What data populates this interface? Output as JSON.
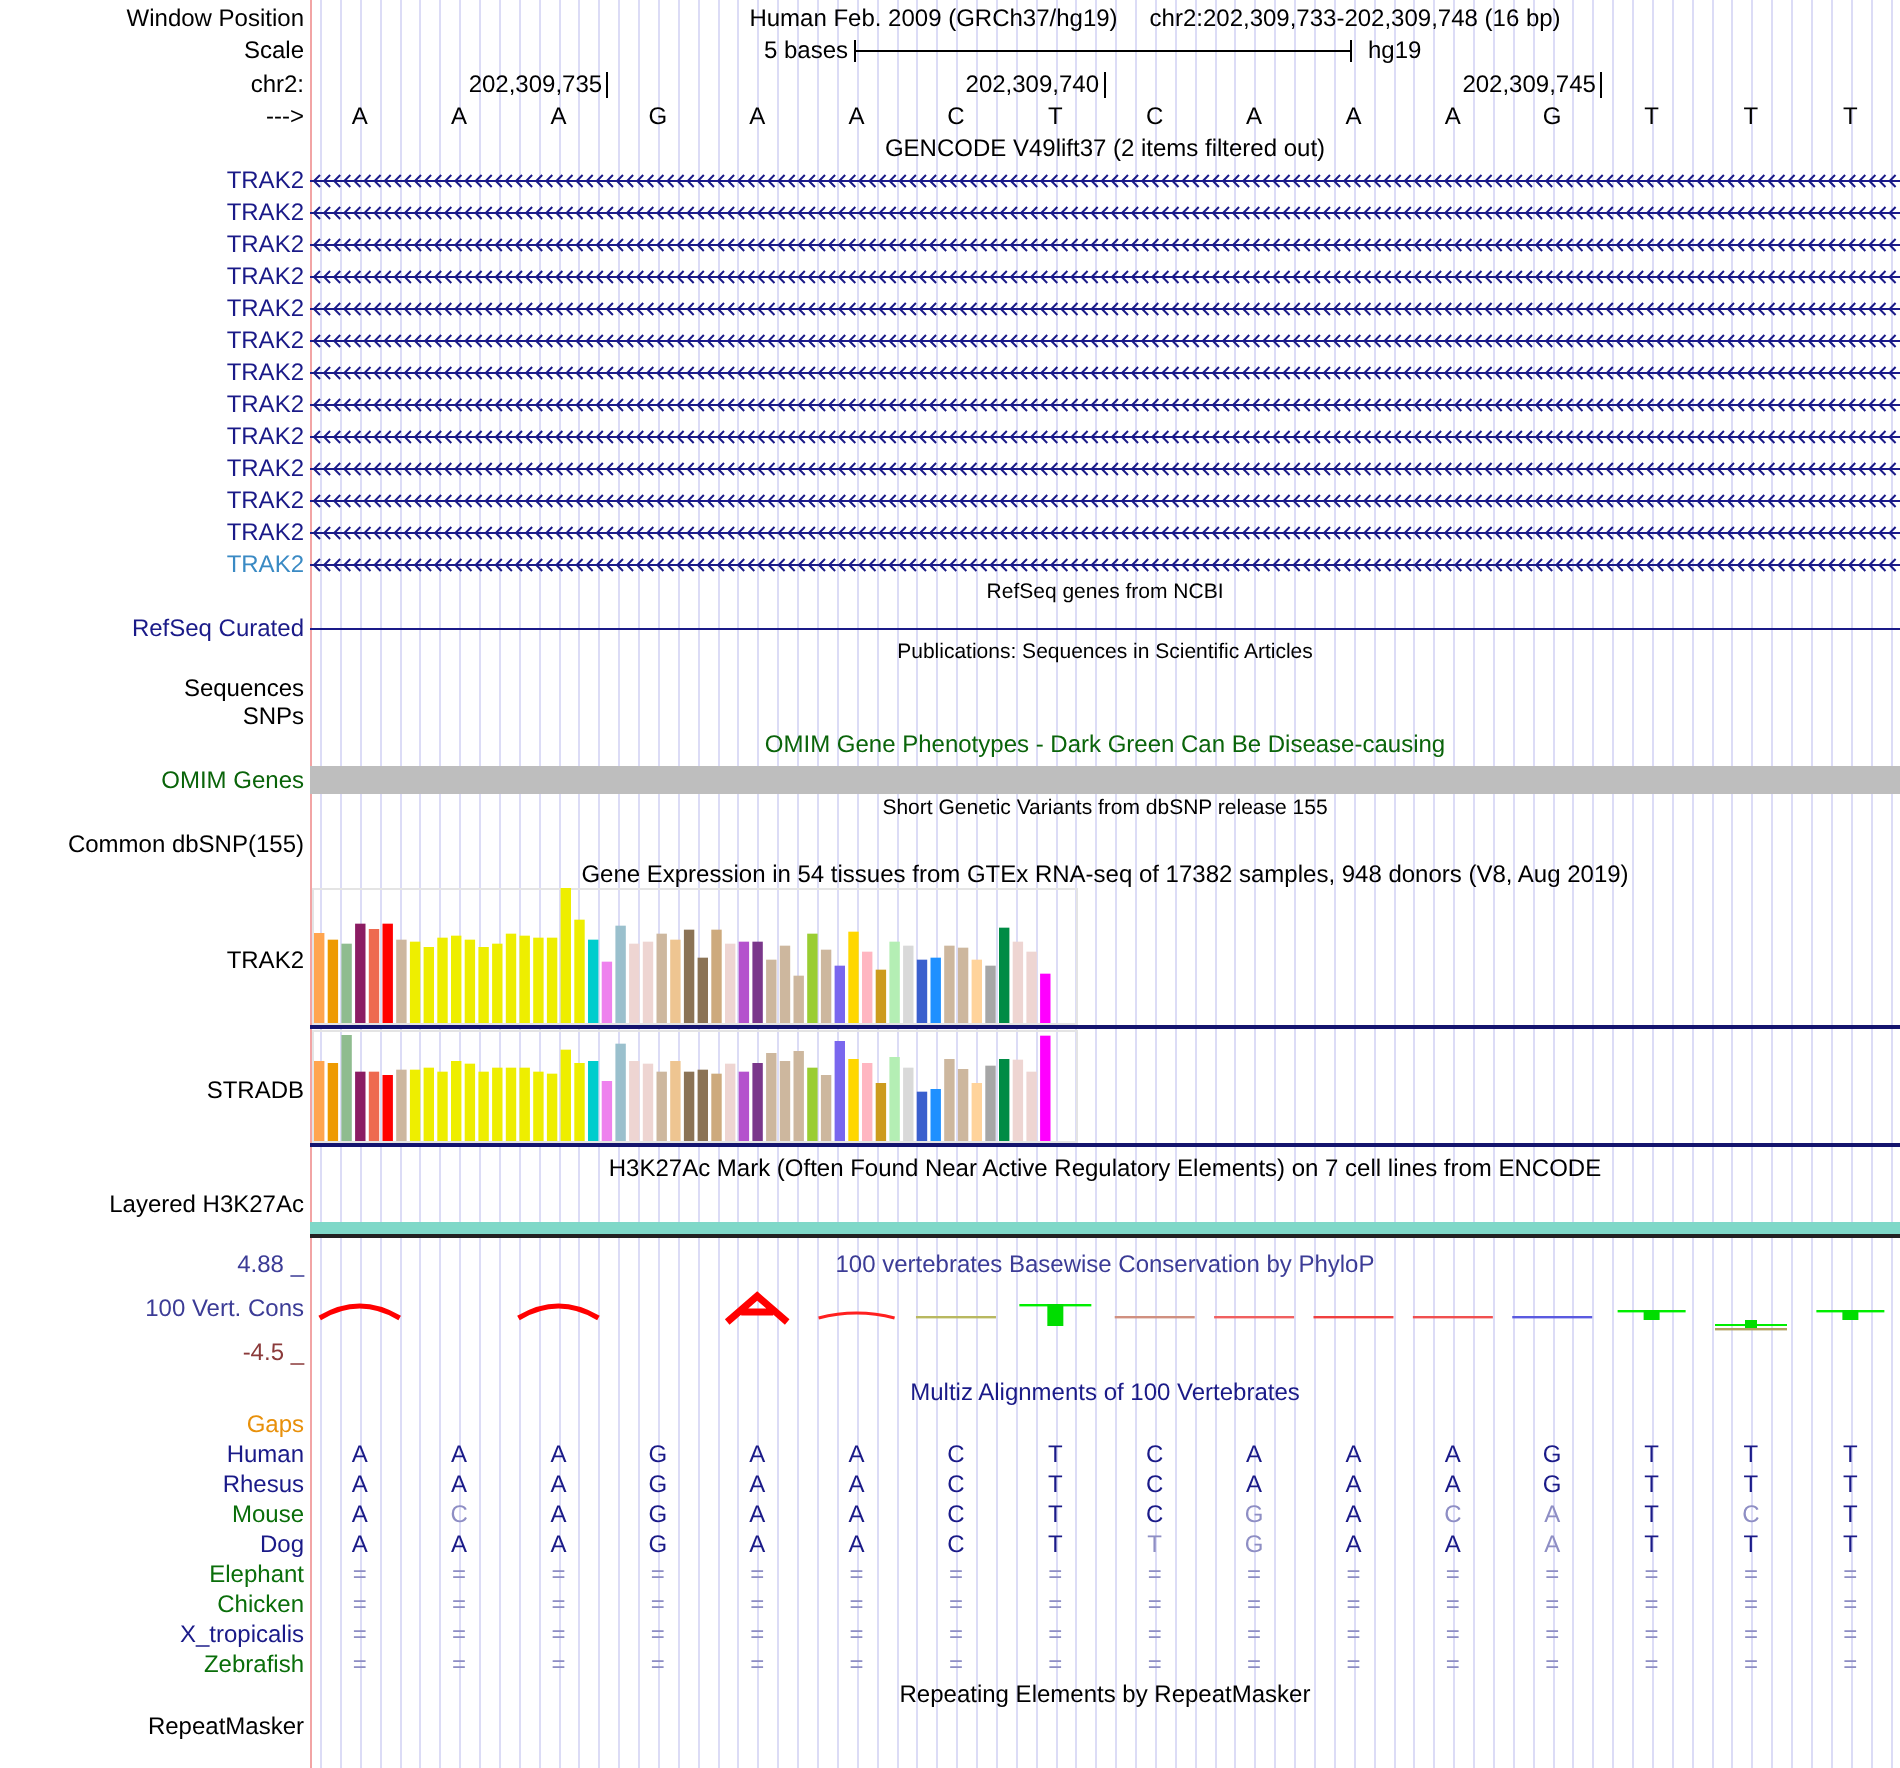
{
  "header": {
    "window_position_label": "Window Position",
    "assembly": "Human Feb. 2009 (GRCh37/hg19)",
    "position": "chr2:202,309,733-202,309,748 (16 bp)",
    "scale_label": "Scale",
    "scale_text": "5 bases",
    "scale_db": "hg19",
    "chrom_label": "chr2:",
    "ruler": [
      "202,309,735",
      "202,309,740",
      "202,309,745"
    ],
    "strand_label": "--->",
    "bases": [
      "A",
      "A",
      "A",
      "G",
      "A",
      "A",
      "C",
      "T",
      "C",
      "A",
      "A",
      "A",
      "G",
      "T",
      "T",
      "T"
    ]
  },
  "tracks": [
    {
      "kind": "genes",
      "heading": {
        "text": "GENCODE V49lift37 (2 items filtered out)",
        "small": false,
        "color": "#000000"
      },
      "items": [
        {
          "label": "TRAK2",
          "color": "#1a1a88"
        },
        {
          "label": "TRAK2",
          "color": "#1a1a88"
        },
        {
          "label": "TRAK2",
          "color": "#1a1a88"
        },
        {
          "label": "TRAK2",
          "color": "#1a1a88"
        },
        {
          "label": "TRAK2",
          "color": "#1a1a88"
        },
        {
          "label": "TRAK2",
          "color": "#1a1a88"
        },
        {
          "label": "TRAK2",
          "color": "#1a1a88"
        },
        {
          "label": "TRAK2",
          "color": "#1a1a88"
        },
        {
          "label": "TRAK2",
          "color": "#1a1a88"
        },
        {
          "label": "TRAK2",
          "color": "#1a1a88"
        },
        {
          "label": "TRAK2",
          "color": "#1a1a88"
        },
        {
          "label": "TRAK2",
          "color": "#1a1a88"
        },
        {
          "label": "TRAK2",
          "color": "#3a8ac4"
        }
      ]
    },
    {
      "kind": "line",
      "heading": {
        "text": "RefSeq genes from NCBI",
        "small": true,
        "color": "#000000"
      },
      "labels": [
        {
          "label": "RefSeq Curated",
          "color": "#1a1a88"
        }
      ]
    },
    {
      "kind": "empty",
      "heading": {
        "text": "Publications: Sequences in Scientific Articles",
        "small": true,
        "color": "#000000"
      },
      "labels": [
        {
          "label": "Sequences",
          "color": "#000000"
        },
        {
          "label": "SNPs",
          "color": "#000000"
        }
      ]
    },
    {
      "kind": "bar",
      "heading": {
        "text": "OMIM Gene Phenotypes - Dark Green Can Be Disease-causing",
        "small": false,
        "color": "#0a640a"
      },
      "labels": [
        {
          "label": "OMIM Genes",
          "color": "#0a640a"
        }
      ]
    },
    {
      "kind": "empty",
      "heading": {
        "text": "Short Genetic Variants from dbSNP release 155",
        "small": true,
        "color": "#000000"
      },
      "labels": [
        {
          "label": "Common dbSNP(155)",
          "color": "#000000"
        }
      ]
    },
    {
      "kind": "expression",
      "heading": {
        "text": "Gene Expression in 54 tissues from GTEx RNA-seq of 17382 samples, 948 donors (V8, Aug 2019)",
        "small": false,
        "color": "#000000"
      },
      "labels": [
        {
          "label": "TRAK2",
          "color": "#000000"
        },
        {
          "label": "STRADB",
          "color": "#000000"
        }
      ]
    },
    {
      "kind": "h3k27ac",
      "heading": {
        "text": "H3K27Ac Mark (Often Found Near Active Regulatory Elements) on 7 cell lines from ENCODE",
        "small": false,
        "color": "#000000"
      },
      "labels": [
        {
          "label": "Layered H3K27Ac",
          "color": "#000000"
        }
      ]
    },
    {
      "kind": "phylop",
      "heading": {
        "text": "100 vertebrates Basewise Conservation by PhyloP",
        "small": false,
        "color": "#3c3c96"
      },
      "max": "4.88 _",
      "min": "-4.5 _",
      "labels": [
        {
          "label": "100 Vert. Cons",
          "color": "#3c3c96"
        }
      ]
    },
    {
      "kind": "multiz",
      "heading": {
        "text": "Multiz Alignments of 100 Vertebrates",
        "small": false,
        "color": "#1a1a88"
      },
      "gaps_label": "Gaps",
      "species": [
        {
          "label": "Human",
          "color": "#1a1a88",
          "bases": [
            {
              "b": "A",
              "faded": false
            },
            {
              "b": "A",
              "faded": false
            },
            {
              "b": "A",
              "faded": false
            },
            {
              "b": "G",
              "faded": false
            },
            {
              "b": "A",
              "faded": false
            },
            {
              "b": "A",
              "faded": false
            },
            {
              "b": "C",
              "faded": false
            },
            {
              "b": "T",
              "faded": false
            },
            {
              "b": "C",
              "faded": false
            },
            {
              "b": "A",
              "faded": false
            },
            {
              "b": "A",
              "faded": false
            },
            {
              "b": "A",
              "faded": false
            },
            {
              "b": "G",
              "faded": false
            },
            {
              "b": "T",
              "faded": false
            },
            {
              "b": "T",
              "faded": false
            },
            {
              "b": "T",
              "faded": false
            }
          ]
        },
        {
          "label": "Rhesus",
          "color": "#1a1a88",
          "bases": [
            {
              "b": "A",
              "faded": false
            },
            {
              "b": "A",
              "faded": false
            },
            {
              "b": "A",
              "faded": false
            },
            {
              "b": "G",
              "faded": false
            },
            {
              "b": "A",
              "faded": false
            },
            {
              "b": "A",
              "faded": false
            },
            {
              "b": "C",
              "faded": false
            },
            {
              "b": "T",
              "faded": false
            },
            {
              "b": "C",
              "faded": false
            },
            {
              "b": "A",
              "faded": false
            },
            {
              "b": "A",
              "faded": false
            },
            {
              "b": "A",
              "faded": false
            },
            {
              "b": "G",
              "faded": false
            },
            {
              "b": "T",
              "faded": false
            },
            {
              "b": "T",
              "faded": false
            },
            {
              "b": "T",
              "faded": false
            }
          ]
        },
        {
          "label": "Mouse",
          "color": "#0a6e0a",
          "bases": [
            {
              "b": "A",
              "faded": false
            },
            {
              "b": "C",
              "faded": true
            },
            {
              "b": "A",
              "faded": false
            },
            {
              "b": "G",
              "faded": false
            },
            {
              "b": "A",
              "faded": false
            },
            {
              "b": "A",
              "faded": false
            },
            {
              "b": "C",
              "faded": false
            },
            {
              "b": "T",
              "faded": false
            },
            {
              "b": "C",
              "faded": false
            },
            {
              "b": "G",
              "faded": true
            },
            {
              "b": "A",
              "faded": false
            },
            {
              "b": "C",
              "faded": true
            },
            {
              "b": "A",
              "faded": true
            },
            {
              "b": "T",
              "faded": false
            },
            {
              "b": "C",
              "faded": true
            },
            {
              "b": "T",
              "faded": false
            }
          ]
        },
        {
          "label": "Dog",
          "color": "#1a1a88",
          "bases": [
            {
              "b": "A",
              "faded": false
            },
            {
              "b": "A",
              "faded": false
            },
            {
              "b": "A",
              "faded": false
            },
            {
              "b": "G",
              "faded": false
            },
            {
              "b": "A",
              "faded": false
            },
            {
              "b": "A",
              "faded": false
            },
            {
              "b": "C",
              "faded": false
            },
            {
              "b": "T",
              "faded": false
            },
            {
              "b": "T",
              "faded": true
            },
            {
              "b": "G",
              "faded": true
            },
            {
              "b": "A",
              "faded": false
            },
            {
              "b": "A",
              "faded": false
            },
            {
              "b": "A",
              "faded": true
            },
            {
              "b": "T",
              "faded": false
            },
            {
              "b": "T",
              "faded": false
            },
            {
              "b": "T",
              "faded": false
            }
          ]
        },
        {
          "label": "Elephant",
          "color": "#0a6e0a",
          "bases": [
            {
              "b": "=",
              "faded": true
            },
            {
              "b": "=",
              "faded": true
            },
            {
              "b": "=",
              "faded": true
            },
            {
              "b": "=",
              "faded": true
            },
            {
              "b": "=",
              "faded": true
            },
            {
              "b": "=",
              "faded": true
            },
            {
              "b": "=",
              "faded": true
            },
            {
              "b": "=",
              "faded": true
            },
            {
              "b": "=",
              "faded": true
            },
            {
              "b": "=",
              "faded": true
            },
            {
              "b": "=",
              "faded": true
            },
            {
              "b": "=",
              "faded": true
            },
            {
              "b": "=",
              "faded": true
            },
            {
              "b": "=",
              "faded": true
            },
            {
              "b": "=",
              "faded": true
            },
            {
              "b": "=",
              "faded": true
            }
          ]
        },
        {
          "label": "Chicken",
          "color": "#0a6e0a",
          "bases": [
            {
              "b": "=",
              "faded": true
            },
            {
              "b": "=",
              "faded": true
            },
            {
              "b": "=",
              "faded": true
            },
            {
              "b": "=",
              "faded": true
            },
            {
              "b": "=",
              "faded": true
            },
            {
              "b": "=",
              "faded": true
            },
            {
              "b": "=",
              "faded": true
            },
            {
              "b": "=",
              "faded": true
            },
            {
              "b": "=",
              "faded": true
            },
            {
              "b": "=",
              "faded": true
            },
            {
              "b": "=",
              "faded": true
            },
            {
              "b": "=",
              "faded": true
            },
            {
              "b": "=",
              "faded": true
            },
            {
              "b": "=",
              "faded": true
            },
            {
              "b": "=",
              "faded": true
            },
            {
              "b": "=",
              "faded": true
            }
          ]
        },
        {
          "label": "X_tropicalis",
          "color": "#1a1a88",
          "bases": [
            {
              "b": "=",
              "faded": true
            },
            {
              "b": "=",
              "faded": true
            },
            {
              "b": "=",
              "faded": true
            },
            {
              "b": "=",
              "faded": true
            },
            {
              "b": "=",
              "faded": true
            },
            {
              "b": "=",
              "faded": true
            },
            {
              "b": "=",
              "faded": true
            },
            {
              "b": "=",
              "faded": true
            },
            {
              "b": "=",
              "faded": true
            },
            {
              "b": "=",
              "faded": true
            },
            {
              "b": "=",
              "faded": true
            },
            {
              "b": "=",
              "faded": true
            },
            {
              "b": "=",
              "faded": true
            },
            {
              "b": "=",
              "faded": true
            },
            {
              "b": "=",
              "faded": true
            },
            {
              "b": "=",
              "faded": true
            }
          ]
        },
        {
          "label": "Zebrafish",
          "color": "#0a6e0a",
          "bases": [
            {
              "b": "=",
              "faded": true
            },
            {
              "b": "=",
              "faded": true
            },
            {
              "b": "=",
              "faded": true
            },
            {
              "b": "=",
              "faded": true
            },
            {
              "b": "=",
              "faded": true
            },
            {
              "b": "=",
              "faded": true
            },
            {
              "b": "=",
              "faded": true
            },
            {
              "b": "=",
              "faded": true
            },
            {
              "b": "=",
              "faded": true
            },
            {
              "b": "=",
              "faded": true
            },
            {
              "b": "=",
              "faded": true
            },
            {
              "b": "=",
              "faded": true
            },
            {
              "b": "=",
              "faded": true
            },
            {
              "b": "=",
              "faded": true
            },
            {
              "b": "=",
              "faded": true
            },
            {
              "b": "=",
              "faded": true
            }
          ]
        }
      ]
    },
    {
      "kind": "empty",
      "heading": {
        "text": "Repeating Elements by RepeatMasker",
        "small": false,
        "color": "#000000"
      },
      "labels": [
        {
          "label": "RepeatMasker",
          "color": "#000000"
        }
      ]
    }
  ]
}
